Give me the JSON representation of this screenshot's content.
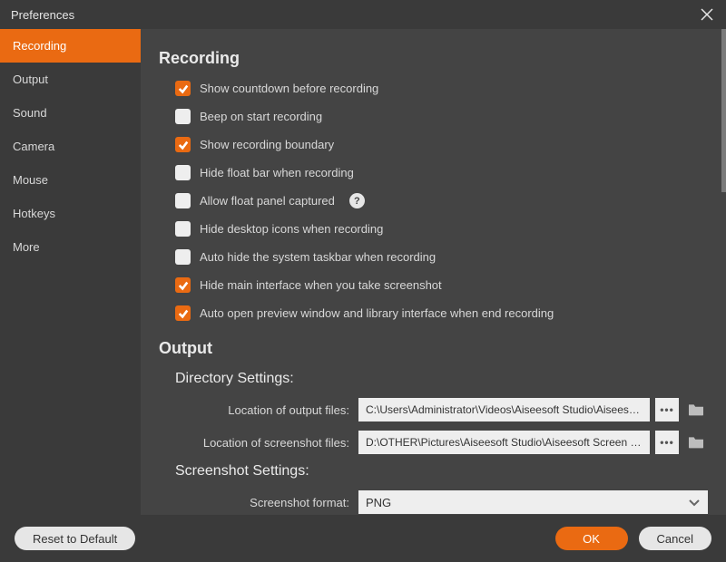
{
  "window": {
    "title": "Preferences"
  },
  "sidebar": {
    "items": [
      {
        "label": "Recording",
        "active": true
      },
      {
        "label": "Output",
        "active": false
      },
      {
        "label": "Sound",
        "active": false
      },
      {
        "label": "Camera",
        "active": false
      },
      {
        "label": "Mouse",
        "active": false
      },
      {
        "label": "Hotkeys",
        "active": false
      },
      {
        "label": "More",
        "active": false
      }
    ]
  },
  "sections": {
    "recording": {
      "title": "Recording",
      "options": [
        {
          "label": "Show countdown before recording",
          "checked": true
        },
        {
          "label": "Beep on start recording",
          "checked": false
        },
        {
          "label": "Show recording boundary",
          "checked": true
        },
        {
          "label": "Hide float bar when recording",
          "checked": false
        },
        {
          "label": "Allow float panel captured",
          "checked": false,
          "help": true
        },
        {
          "label": "Hide desktop icons when recording",
          "checked": false
        },
        {
          "label": "Auto hide the system taskbar when recording",
          "checked": false
        },
        {
          "label": "Hide main interface when you take screenshot",
          "checked": true
        },
        {
          "label": "Auto open preview window and library interface when end recording",
          "checked": true
        }
      ]
    },
    "output": {
      "title": "Output",
      "directory": {
        "title": "Directory Settings:",
        "output_label": "Location of output files:",
        "output_value": "C:\\Users\\Administrator\\Videos\\Aiseesoft Studio\\Aiseesoft S",
        "screenshot_label": "Location of screenshot files:",
        "screenshot_value": "D:\\OTHER\\Pictures\\Aiseesoft Studio\\Aiseesoft Screen Recor"
      },
      "screenshot": {
        "title": "Screenshot Settings:",
        "format_label": "Screenshot format:",
        "format_value": "PNG"
      }
    }
  },
  "footer": {
    "reset": "Reset to Default",
    "ok": "OK",
    "cancel": "Cancel"
  }
}
